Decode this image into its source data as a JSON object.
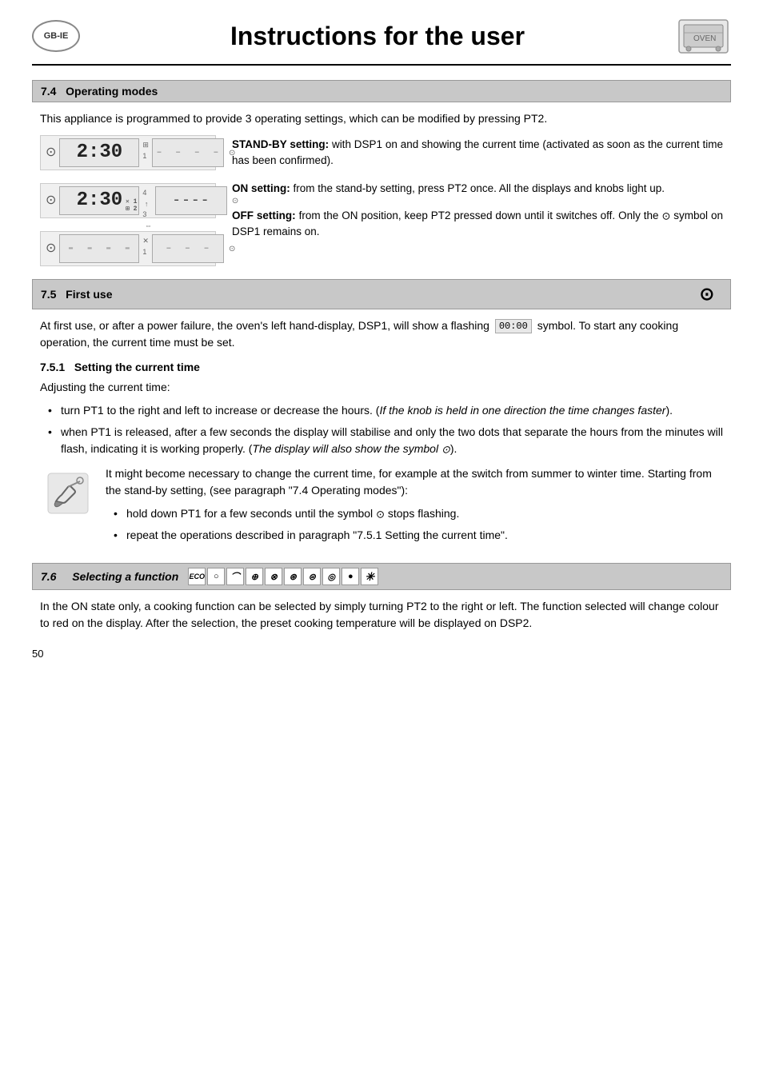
{
  "header": {
    "logo": "GB-IE",
    "title": "Instructions for the user"
  },
  "section74": {
    "number": "7.4",
    "title": "Operating modes",
    "intro": "This appliance is programmed to provide 3 operating settings, which can be modified by pressing PT2.",
    "modes": [
      {
        "id": "standby",
        "dsp1_value": "2:30",
        "dsp2_value": "----",
        "title": "STAND-BY setting:",
        "description": "with DSP1 on and showing the current time (activated as soon as the current time has been confirmed)."
      },
      {
        "id": "on",
        "dsp1_value": "2:30",
        "dsp2_value": "----",
        "title": "ON setting:",
        "description": "from the stand-by setting, press PT2 once. All the displays and knobs light up."
      },
      {
        "id": "off",
        "dsp1_value": "----",
        "dsp2_value": "----",
        "title": "OFF setting:",
        "description": "from the ON position, keep PT2 pressed down until it switches off. Only the ⊙ symbol on DSP1 remains on."
      }
    ]
  },
  "section75": {
    "number": "7.5",
    "title": "First use",
    "intro": "At first use, or after a power failure, the oven's left hand-display, DSP1, will show a flashing",
    "intro2": "symbol. To start any cooking operation, the current time must be set.",
    "flashing_symbol": "00:00",
    "subsection751": {
      "number": "7.5.1",
      "title": "Setting the current time",
      "intro": "Adjusting the current time:",
      "bullets": [
        "turn PT1 to the right and left to increase or decrease the hours. (If the knob is held in one direction the time changes faster).",
        "when PT1 is released, after a few seconds the display will stabilise and only the two dots that separate the hours from the minutes will flash, indicating it is working properly. (The display will also show the symbol ⊙)."
      ]
    },
    "note": "It might become necessary to change the current time, for example at the switch from summer to winter time. Starting from the stand-by setting, (see paragraph \"7.4 Operating modes\"):",
    "note_bullets": [
      "hold down PT1 for a few seconds until the symbol ⊙ stops flashing.",
      "repeat the operations described in paragraph \"7.5.1 Setting the current time\"."
    ]
  },
  "section76": {
    "number": "7.6",
    "title": "Selecting a function",
    "description": "In the ON state only, a cooking function can be selected by simply turning PT2 to the right or left. The function selected will change colour to red on the display. After the selection, the preset cooking temperature will be displayed on DSP2.",
    "function_icons": [
      "ECO",
      "○",
      "⌒",
      "⊕",
      "⊗",
      "⊛",
      "⊜",
      "◎",
      "●",
      "✳"
    ]
  },
  "page_number": "50"
}
